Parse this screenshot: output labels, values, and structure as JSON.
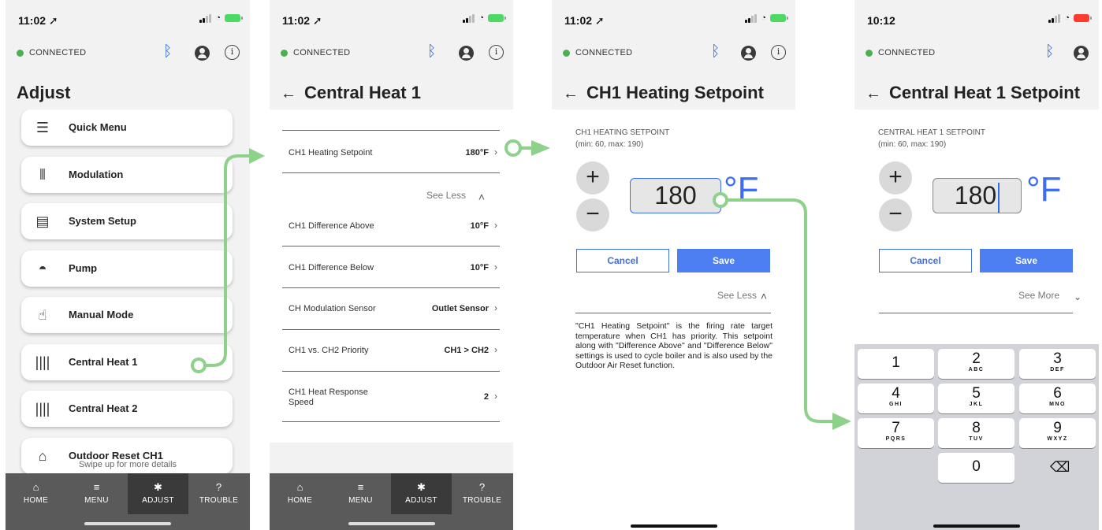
{
  "status": {
    "time_1": "11:02 ➚",
    "time_2": "11:02 ➚",
    "time_3": "11:02 ➚",
    "time_4": "10:12",
    "wifi_icon": "wifi-icon",
    "battery_icon": "battery-icon"
  },
  "connection": {
    "label": "CONNECTED",
    "color": "#4caf50",
    "bluetooth_icon": "bluetooth-icon",
    "account_icon": "account-icon",
    "info_icon": "info-icon"
  },
  "screen1": {
    "title": "Adjust",
    "menu": [
      {
        "label": "Quick Menu",
        "icon": "hamburger-icon"
      },
      {
        "label": "Modulation",
        "icon": "vibrate-icon"
      },
      {
        "label": "System Setup",
        "icon": "server-icon"
      },
      {
        "label": "Pump",
        "icon": "water-drop-icon"
      },
      {
        "label": "Manual Mode",
        "icon": "pointer-hand-icon"
      },
      {
        "label": "Central Heat 1",
        "icon": "radiator-icon"
      },
      {
        "label": "Central Heat 2",
        "icon": "radiator-icon"
      },
      {
        "label": "Outdoor Reset CH1",
        "icon": "house-icon"
      }
    ],
    "swipe_hint": "Swipe up for more details"
  },
  "tabs": [
    {
      "label": "HOME",
      "icon": "home-icon"
    },
    {
      "label": "MENU",
      "icon": "list-icon"
    },
    {
      "label": "ADJUST",
      "icon": "gear-icon",
      "active": true
    },
    {
      "label": "TROUBLE",
      "icon": "help-icon"
    }
  ],
  "screen2": {
    "back": "←",
    "title": "Central Heat 1",
    "rows": [
      {
        "label": "CH1 Heating Setpoint",
        "value": "180°F"
      },
      {
        "label": "CH1 Difference Above",
        "value": "10°F"
      },
      {
        "label": "CH1 Difference Below",
        "value": "10°F"
      },
      {
        "label": "CH Modulation Sensor",
        "value": "Outlet Sensor"
      },
      {
        "label": "CH1 vs. CH2 Priority",
        "value": "CH1 > CH2"
      },
      {
        "label": "CH1 Heat Response Speed",
        "value": "2"
      }
    ],
    "see_less": "See Less"
  },
  "screen3": {
    "back": "←",
    "title": "CH1 Heating Setpoint",
    "caption": "CH1 HEATING SETPOINT",
    "range": "(min: 60, max: 190)",
    "plus": "+",
    "minus": "−",
    "value": "180",
    "unit": "°F",
    "cancel": "Cancel",
    "save": "Save",
    "see_less": "See Less",
    "description": "\"CH1 Heating Setpoint\" is the firing rate target temperature when CH1 has priority. This setpoint along with \"Difference Above\" and \"Difference Below\" settings is used to cycle boiler and is also used by the Outdoor Air Reset function."
  },
  "screen4": {
    "back": "←",
    "title": "Central Heat 1 Setpoint",
    "caption": "CENTRAL HEAT 1 SETPOINT",
    "range": "(min: 60, max: 190)",
    "plus": "+",
    "minus": "−",
    "value": "180",
    "unit": "°F",
    "cancel": "Cancel",
    "save": "Save",
    "see_more": "See More",
    "keys": [
      {
        "n": "1",
        "l": ""
      },
      {
        "n": "2",
        "l": "ABC"
      },
      {
        "n": "3",
        "l": "DEF"
      },
      {
        "n": "4",
        "l": "GHI"
      },
      {
        "n": "5",
        "l": "JKL"
      },
      {
        "n": "6",
        "l": "MNO"
      },
      {
        "n": "7",
        "l": "PQRS"
      },
      {
        "n": "8",
        "l": "TUV"
      },
      {
        "n": "9",
        "l": "WXYZ"
      },
      {
        "n": "0",
        "l": ""
      }
    ],
    "delete": "⌫"
  },
  "colors": {
    "accent": "#3d6df2",
    "save_button": "#4d7ef2",
    "arrow": "#8ed18b",
    "tabbar": "#5a5a5a"
  }
}
